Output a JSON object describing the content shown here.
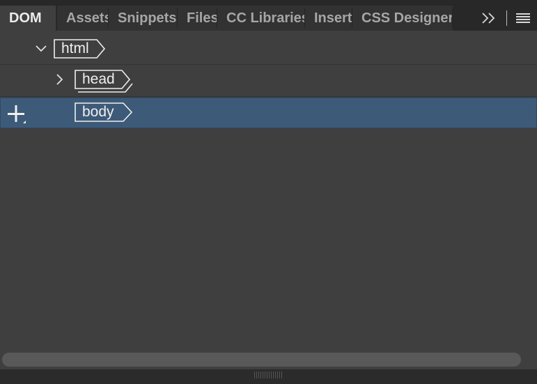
{
  "tabs": [
    {
      "label": "DOM",
      "active": true
    },
    {
      "label": "Assets",
      "active": false
    },
    {
      "label": "Snippets",
      "active": false
    },
    {
      "label": "Files",
      "active": false
    },
    {
      "label": "CC Libraries",
      "active": false
    },
    {
      "label": "Insert",
      "active": false
    },
    {
      "label": "CSS Designer",
      "active": false
    }
  ],
  "toolbar": {
    "overflow_icon": "double-chevron-right-icon",
    "menu_icon": "hamburger-menu-icon"
  },
  "tree": {
    "html": {
      "label": "html",
      "expanded": true
    },
    "head": {
      "label": "head",
      "expanded": false
    },
    "body": {
      "label": "body",
      "selected": true
    }
  },
  "colors": {
    "panel_bg": "#3f3f3f",
    "selected_row": "#3d5a78",
    "tag_border": "#efefef"
  }
}
